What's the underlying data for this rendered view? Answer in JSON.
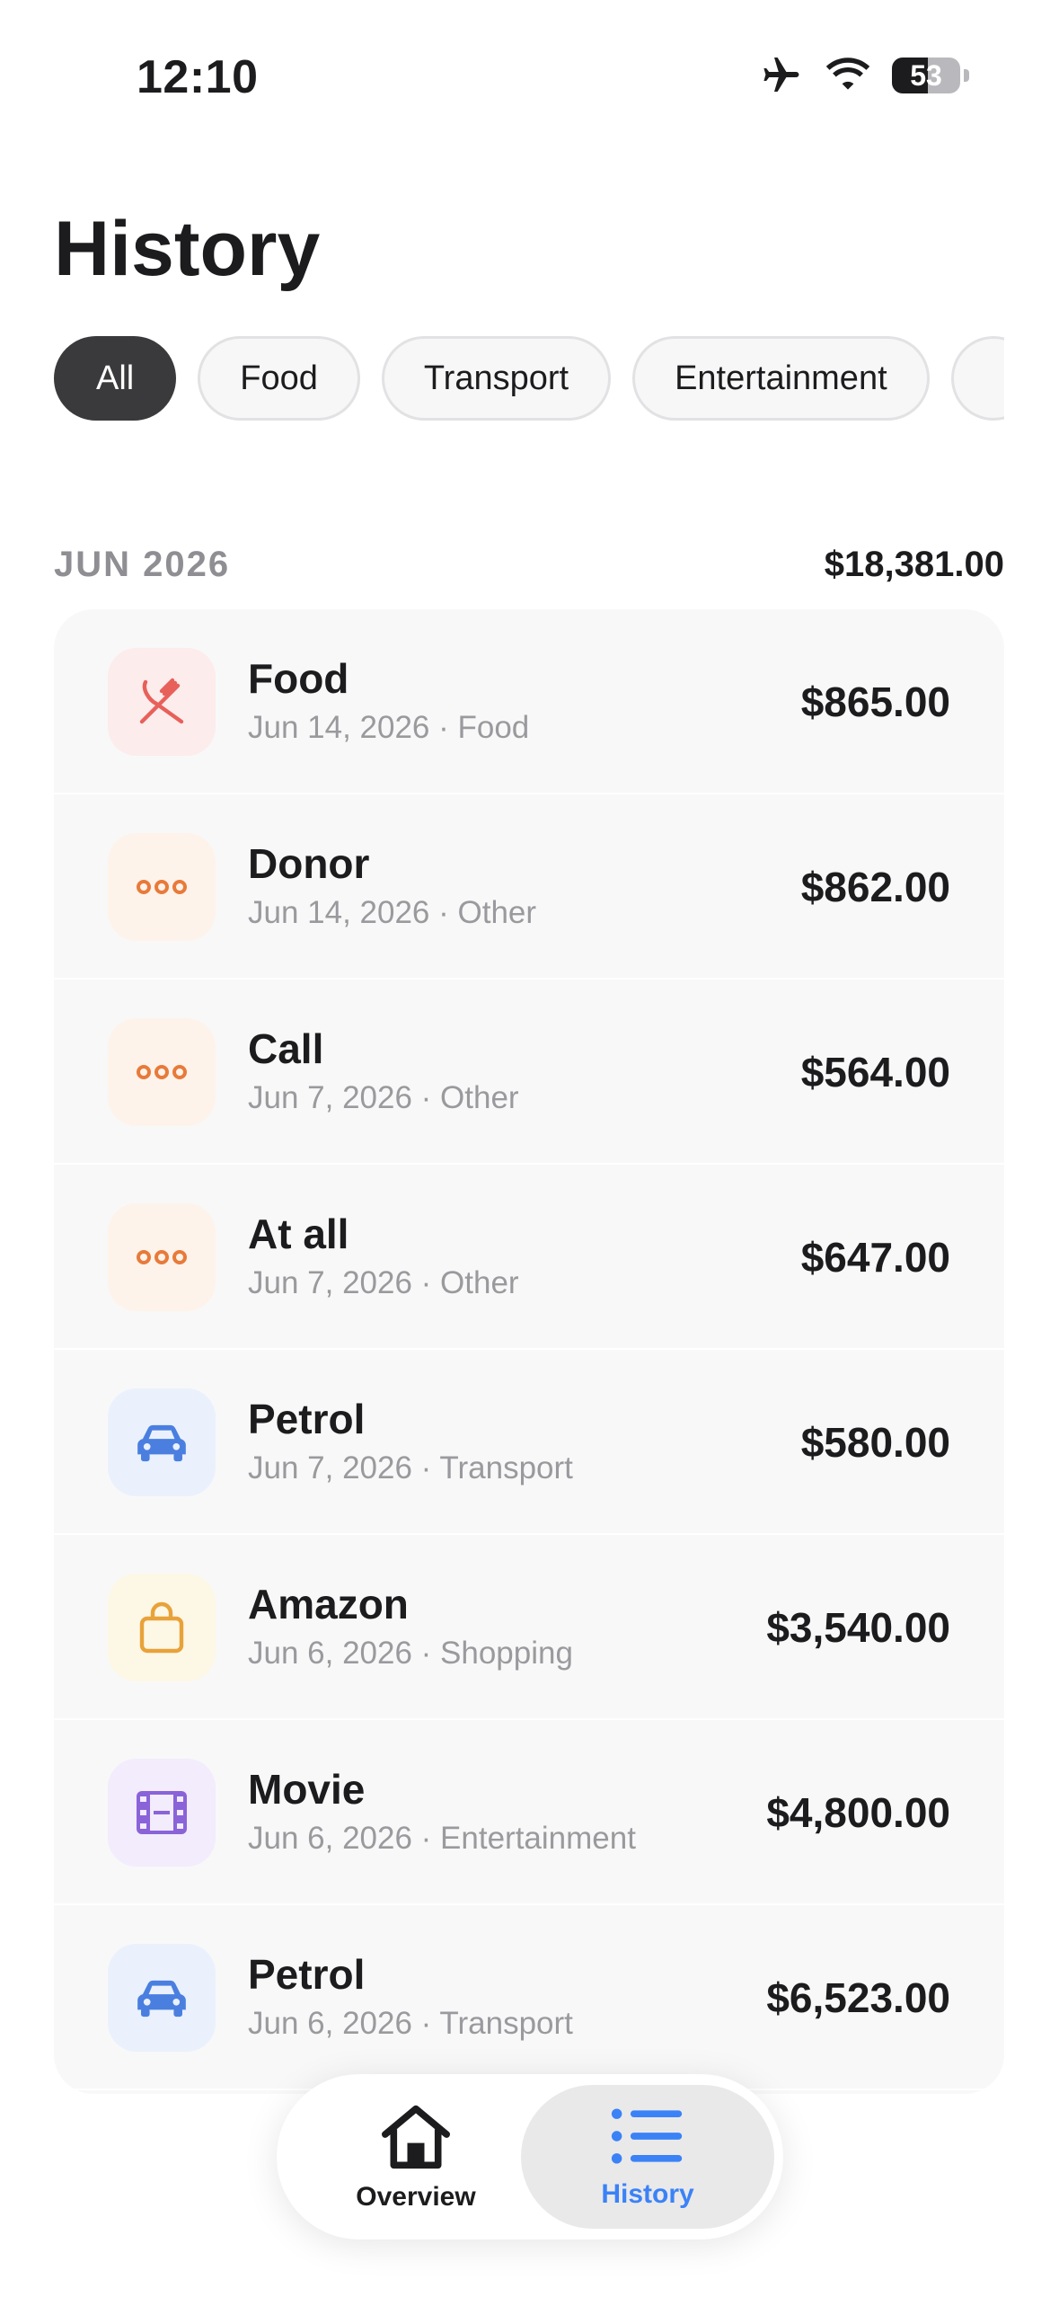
{
  "status": {
    "time": "12:10",
    "battery": "53",
    "battery_level": 0.53
  },
  "title": "History",
  "filters": [
    {
      "label": "All",
      "active": true
    },
    {
      "label": "Food",
      "active": false
    },
    {
      "label": "Transport",
      "active": false
    },
    {
      "label": "Entertainment",
      "active": false
    },
    {
      "label": "",
      "active": false
    }
  ],
  "section": {
    "month": "JUN 2026",
    "total": "$18,381.00"
  },
  "transactions": [
    {
      "title": "Food",
      "subtitle": "Jun 14, 2026 · Food",
      "amount": "$865.00",
      "icon": "fork-knife-icon",
      "color": "#e8605a",
      "bg": "#fdecec"
    },
    {
      "title": "Donor",
      "subtitle": "Jun 14, 2026 · Other",
      "amount": "$862.00",
      "icon": "more-icon",
      "color": "#e87a3a",
      "bg": "#fdf3ea"
    },
    {
      "title": "Call",
      "subtitle": "Jun 7, 2026 · Other",
      "amount": "$564.00",
      "icon": "more-icon",
      "color": "#e87a3a",
      "bg": "#fdf3ea"
    },
    {
      "title": "At all",
      "subtitle": "Jun 7, 2026 · Other",
      "amount": "$647.00",
      "icon": "more-icon",
      "color": "#e87a3a",
      "bg": "#fdf3ea"
    },
    {
      "title": "Petrol",
      "subtitle": "Jun 7, 2026 · Transport",
      "amount": "$580.00",
      "icon": "car-icon",
      "color": "#4a7fe0",
      "bg": "#eaf1fd"
    },
    {
      "title": "Amazon",
      "subtitle": "Jun 6, 2026 · Shopping",
      "amount": "$3,540.00",
      "icon": "shopping-bag-icon",
      "color": "#e8a23a",
      "bg": "#fdf7e6"
    },
    {
      "title": "Movie",
      "subtitle": "Jun 6, 2026 · Entertainment",
      "amount": "$4,800.00",
      "icon": "film-icon",
      "color": "#8a63d9",
      "bg": "#f2ecfc"
    },
    {
      "title": "Petrol",
      "subtitle": "Jun 6, 2026 · Transport",
      "amount": "$6,523.00",
      "icon": "car-icon",
      "color": "#4a7fe0",
      "bg": "#eaf1fd"
    }
  ],
  "tabs": {
    "overview": {
      "label": "Overview",
      "icon": "house-icon"
    },
    "history": {
      "label": "History",
      "icon": "list-icon",
      "active_color": "#3b82f6"
    }
  }
}
